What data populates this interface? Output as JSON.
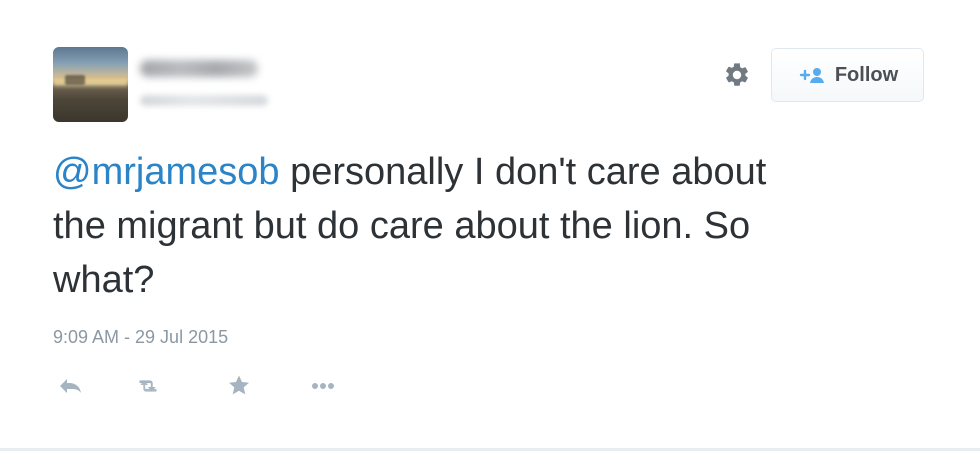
{
  "tweet": {
    "author_name_blurred": "",
    "author_handle_blurred": "",
    "follow_button": {
      "label": "Follow",
      "icon": "add-user-icon"
    },
    "settings_icon": "gear-icon",
    "text": {
      "mention": "@mrjamesob",
      "body_line_1": " personally I don't care about",
      "body_line_2": "the migrant but do care about the lion. So",
      "body_line_3": "what?"
    },
    "timestamp": "9:09 AM - 29 Jul 2015",
    "actions": [
      {
        "name": "reply",
        "icon": "reply-icon"
      },
      {
        "name": "retweet",
        "icon": "retweet-icon"
      },
      {
        "name": "favorite",
        "icon": "star-icon"
      },
      {
        "name": "more",
        "icon": "more-icon"
      }
    ],
    "colors": {
      "mention": "#2b84c7",
      "text": "#2d3237",
      "muted": "#8b98a3",
      "icon_muted": "#a5b4c0",
      "border": "#e1e8ed"
    }
  }
}
